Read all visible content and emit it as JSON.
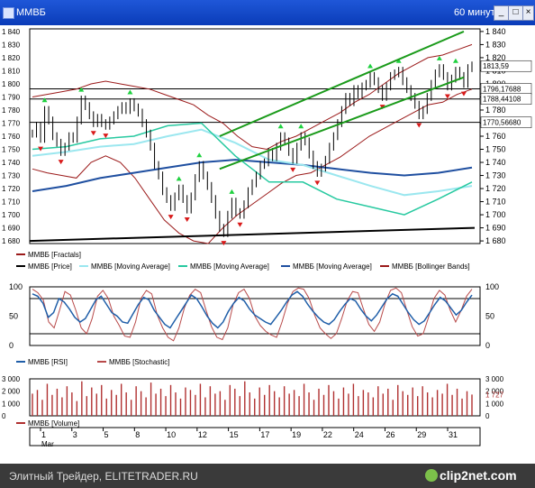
{
  "window": {
    "title": "ММВБ",
    "period": "60 минут",
    "min_label": "_",
    "max_label": "□",
    "close_label": "×"
  },
  "colors": {
    "background": "#ffffff",
    "price": "#000000",
    "ma_fast": "#27c9a0",
    "ma_mid": "#9be7ef",
    "ma_slow": "#1f4fa0",
    "bollinger": "#9b1a1a",
    "channel": "#1b9b1b",
    "fractal_up": "#1fd13f",
    "fractal_down": "#d91a1a",
    "rsi": "#1f5ea8",
    "stochastic": "#b84a4a",
    "volume": "#b03030"
  },
  "legend_main": [
    {
      "label": "ММВБ [Fractals]",
      "color": "#9b1a1a"
    },
    {
      "label": "ММВБ [Price]",
      "color": "#000000"
    },
    {
      "label": "ММВБ [Moving Average]",
      "color": "#9be7ef"
    },
    {
      "label": "ММВБ [Moving Average]",
      "color": "#27c9a0"
    },
    {
      "label": "ММВБ [Moving Average]",
      "color": "#1f4fa0"
    },
    {
      "label": "ММВБ [Bollinger Bands]",
      "color": "#9b1a1a"
    }
  ],
  "legend_osc": [
    {
      "label": "ММВБ [RSI]",
      "color": "#1f5ea8"
    },
    {
      "label": "ММВБ [Stochastic]",
      "color": "#b84a4a"
    }
  ],
  "legend_vol": [
    {
      "label": "ММВБ [Volume]",
      "color": "#b03030"
    }
  ],
  "axis": {
    "price_ticks": [
      "1 840",
      "1 830",
      "1 820",
      "1 810",
      "1 800",
      "1 790",
      "1 780",
      "1 770",
      "1 760",
      "1 750",
      "1 740",
      "1 730",
      "1 720",
      "1 710",
      "1 700",
      "1 690",
      "1 680"
    ],
    "price_values": [
      1840,
      1830,
      1820,
      1810,
      1800,
      1790,
      1780,
      1770,
      1760,
      1750,
      1740,
      1730,
      1720,
      1710,
      1700,
      1690,
      1680
    ],
    "price_range": [
      1678,
      1842
    ],
    "markers": [
      {
        "value": 1813.59,
        "label": "1813,59"
      },
      {
        "value": 1796.17,
        "label": "1796,17688"
      },
      {
        "value": 1788.44,
        "label": "1788,44108"
      },
      {
        "value": 1770.57,
        "label": "1770,56680"
      }
    ],
    "osc_ticks": [
      "100",
      "50",
      "0"
    ],
    "osc_values": [
      100,
      50,
      0
    ],
    "vol_ticks": [
      "3 000",
      "2 000",
      "1 000",
      "0"
    ],
    "vol_values": [
      3000,
      2000,
      1000,
      0
    ],
    "vol_marker": "1 727",
    "x_ticks": [
      "1",
      "3",
      "5",
      "8",
      "10",
      "12",
      "15",
      "17",
      "19",
      "22",
      "24",
      "26",
      "29",
      "31"
    ],
    "x_month": "Mar"
  },
  "horizontal_levels": [
    1796.17,
    1788.44,
    1770.57
  ],
  "chart_data": {
    "type": "line",
    "title": "",
    "x": [
      "1",
      "3",
      "5",
      "8",
      "10",
      "12",
      "15",
      "17",
      "19",
      "22",
      "24",
      "26",
      "29",
      "31"
    ],
    "series": [
      {
        "name": "ММВБ [Price]",
        "values": [
          1765,
          1758,
          1775,
          1758,
          1785,
          1768,
          1722,
          1700,
          1740,
          1688,
          1700,
          1690,
          1725,
          1735
        ]
      },
      {
        "name": "ММВБ [Moving Average]",
        "values": [
          1750,
          1752,
          1758,
          1760,
          1768,
          1770,
          1745,
          1725,
          1725,
          1712,
          1706,
          1700,
          1712,
          1725
        ]
      },
      {
        "name": "ММВБ [Moving Average]",
        "values": [
          1745,
          1748,
          1752,
          1754,
          1760,
          1765,
          1755,
          1742,
          1738,
          1730,
          1722,
          1715,
          1718,
          1722
        ]
      },
      {
        "name": "ММВБ [Moving Average]",
        "values": [
          1718,
          1722,
          1728,
          1732,
          1736,
          1740,
          1742,
          1740,
          1738,
          1735,
          1732,
          1730,
          1732,
          1736
        ]
      }
    ],
    "price_path": [
      1762,
      1768,
      1758,
      1780,
      1772,
      1760,
      1755,
      1748,
      1752,
      1760,
      1758,
      1772,
      1788,
      1783,
      1776,
      1770,
      1774,
      1770,
      1768,
      1772,
      1776,
      1780,
      1783,
      1780,
      1786,
      1782,
      1778,
      1770,
      1762,
      1752,
      1738,
      1730,
      1718,
      1712,
      1706,
      1714,
      1720,
      1712,
      1704,
      1714,
      1728,
      1738,
      1730,
      1722,
      1712,
      1700,
      1690,
      1686,
      1700,
      1710,
      1702,
      1700,
      1708,
      1718,
      1724,
      1730,
      1738,
      1740,
      1748,
      1744,
      1752,
      1760,
      1756,
      1748,
      1742,
      1752,
      1760,
      1756,
      1746,
      1738,
      1732,
      1736,
      1742,
      1752,
      1760,
      1770,
      1780,
      1790,
      1786,
      1796,
      1792,
      1798,
      1800,
      1806,
      1802,
      1796,
      1790,
      1798,
      1806,
      1808,
      1810,
      1802,
      1796,
      1790,
      1784,
      1776,
      1780,
      1790,
      1800,
      1808,
      1812,
      1806,
      1798,
      1804,
      1810,
      1806,
      1800,
      1812,
      1814
    ],
    "bollinger_upper": [
      1790,
      1792,
      1794,
      1796,
      1800,
      1802,
      1800,
      1798,
      1796,
      1792,
      1788,
      1784,
      1776,
      1770,
      1760,
      1752,
      1750,
      1756,
      1760,
      1766,
      1772,
      1778,
      1786,
      1792,
      1800,
      1808,
      1814,
      1820,
      1822,
      1826,
      1830
    ],
    "bollinger_lower": [
      1735,
      1732,
      1730,
      1728,
      1740,
      1745,
      1740,
      1728,
      1712,
      1696,
      1686,
      1680,
      1678,
      1690,
      1700,
      1708,
      1716,
      1724,
      1730,
      1732,
      1738,
      1744,
      1752,
      1760,
      1766,
      1772,
      1778,
      1784,
      1786,
      1792,
      1796
    ],
    "channel_upper": [
      [
        1720,
        1760
      ],
      [
        1760,
        1840
      ]
    ],
    "channel_lower": [
      [
        1720,
        1735
      ],
      [
        1760,
        1805
      ]
    ],
    "support_line": [
      1680,
      1690
    ],
    "ylim": [
      1678,
      1842
    ],
    "rsi": [
      88,
      84,
      72,
      48,
      56,
      80,
      74,
      62,
      48,
      40,
      46,
      62,
      78,
      84,
      70,
      56,
      50,
      40,
      38,
      54,
      70,
      82,
      78,
      60,
      48,
      36,
      30,
      44,
      58,
      72,
      86,
      80,
      66,
      50,
      38,
      30,
      40,
      58,
      72,
      82,
      76,
      62,
      52,
      46,
      40,
      36,
      48,
      60,
      74,
      86,
      92,
      84,
      70,
      58,
      48,
      40,
      36,
      44,
      58,
      70,
      80,
      76,
      62,
      50,
      42,
      52,
      66,
      80,
      88,
      84,
      70,
      56,
      44,
      36,
      42,
      56,
      70,
      82,
      76,
      64,
      52,
      60,
      74,
      86
    ],
    "stochastic": [
      96,
      90,
      78,
      40,
      30,
      60,
      92,
      86,
      60,
      30,
      20,
      46,
      84,
      94,
      80,
      50,
      34,
      16,
      14,
      40,
      80,
      94,
      88,
      52,
      30,
      14,
      8,
      30,
      64,
      86,
      96,
      90,
      60,
      32,
      14,
      10,
      30,
      70,
      90,
      96,
      80,
      50,
      34,
      24,
      18,
      14,
      40,
      72,
      92,
      98,
      96,
      80,
      52,
      30,
      20,
      12,
      20,
      46,
      76,
      92,
      90,
      62,
      36,
      24,
      40,
      72,
      94,
      98,
      90,
      60,
      32,
      16,
      20,
      48,
      80,
      94,
      86,
      60,
      40,
      60,
      84,
      96
    ],
    "osc_ylim": [
      0,
      100
    ],
    "volume": [
      1800,
      2100,
      1300,
      2600,
      1700,
      2200,
      1500,
      2400,
      1900,
      1200,
      2800,
      1600,
      2300,
      1800,
      2500,
      1400,
      2100,
      1700,
      2600,
      1900,
      1300,
      2400,
      2000,
      1500,
      2700,
      1800,
      2200,
      1600,
      2500,
      1900,
      1400,
      2300,
      2100,
      1700,
      2600,
      1500,
      2400,
      1800,
      2000,
      1300,
      2500,
      2200,
      1600,
      2800,
      1900,
      1400,
      2300,
      1700,
      2500,
      2000,
      1500,
      2400,
      1800,
      2100,
      1600,
      2600,
      1900,
      1300,
      2200,
      1700,
      2500,
      2000,
      1400,
      2300,
      1800,
      2600,
      1600,
      2100,
      1900,
      1500,
      2400,
      1800,
      2200,
      1300,
      2500,
      2000,
      1700,
      2300,
      1600,
      2400,
      1900,
      1500,
      2100,
      1800,
      2600,
      1700,
      2200,
      1400,
      2000,
      1727
    ],
    "vol_ylim": [
      0,
      3000
    ]
  }
}
